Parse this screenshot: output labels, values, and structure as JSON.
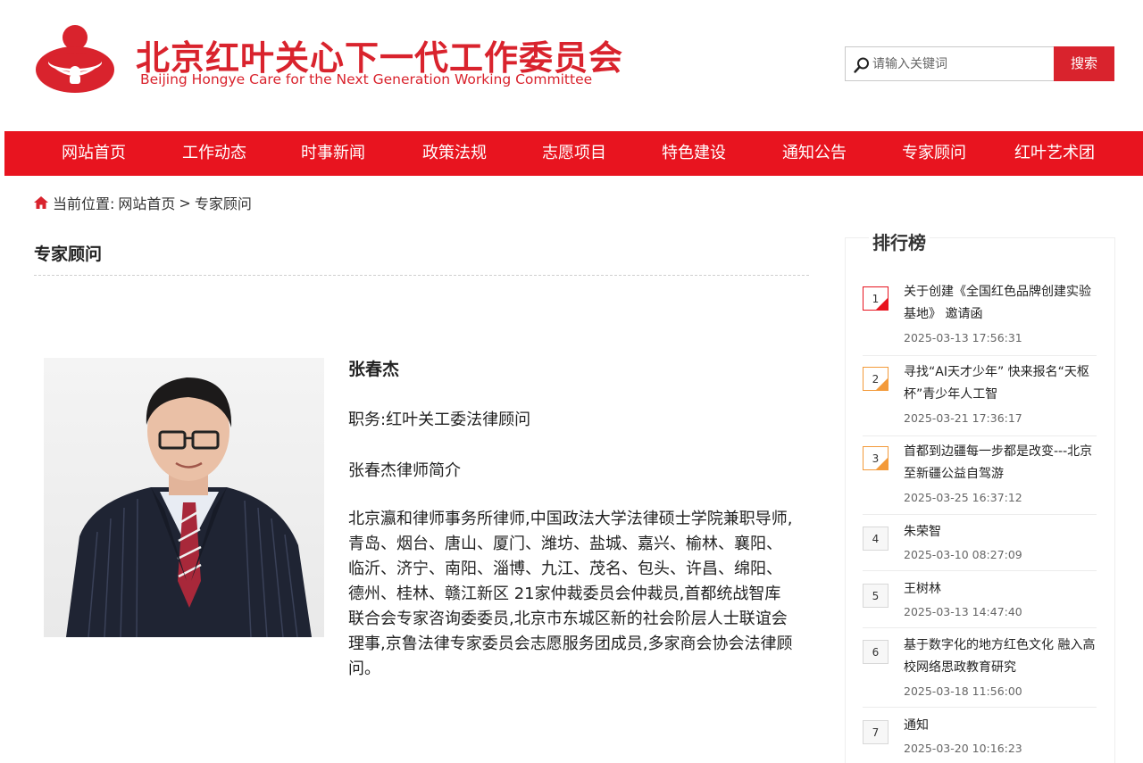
{
  "header": {
    "title_cn": "北京红叶关心下一代工作委员会",
    "title_en": "Beijing Hongye Care for the Next Generation Working Committee",
    "brand_color": "#d9232d",
    "logo_icon": "red-circle-child-logo-icon"
  },
  "search": {
    "placeholder": "请输入关键词",
    "button_label": "搜索",
    "icon": "search-icon"
  },
  "nav": {
    "background": "#e8141f",
    "items": [
      "网站首页",
      "工作动态",
      "时事新闻",
      "政策法规",
      "志愿项目",
      "特色建设",
      "通知公告",
      "专家顾问",
      "红叶艺术团"
    ]
  },
  "breadcrumb": {
    "icon": "home-icon",
    "label": "当前位置:",
    "home": "网站首页",
    "separator": ">",
    "current": "专家顾问"
  },
  "section": {
    "title": "专家顾问"
  },
  "profile": {
    "name": "张春杰",
    "position": "职务:红叶关工委法律顾问",
    "intro_title": "张春杰律师简介",
    "bio": "北京瀛和律师事务所律师,中国政法大学法律硕士学院兼职导师,青岛、烟台、唐山、厦门、潍坊、盐城、嘉兴、榆林、襄阳、临沂、济宁、南阳、淄博、九江、茂名、包头、许昌、绵阳、德州、桂林、赣江新区 21家仲裁委员会仲裁员,首都统战智库联合会专家咨询委委员,北京市东城区新的社会阶层人士联谊会理事,京鲁法律专家委员会志愿服务团成员,多家商会协会法律顾问。"
  },
  "ranking": {
    "title": "排行榜",
    "items": [
      {
        "rank": "1",
        "title": "关于创建《全国红色品牌创建实验基地》 邀请函",
        "date": "2025-03-13 17:56:31"
      },
      {
        "rank": "2",
        "title": "寻找“AI天才少年” 快来报名“天枢杯”青少年人工智",
        "date": "2025-03-21 17:36:17"
      },
      {
        "rank": "3",
        "title": "首都到边疆每一步都是改变---北京至新疆公益自驾游",
        "date": "2025-03-25 16:37:12"
      },
      {
        "rank": "4",
        "title": "朱荣智",
        "date": "2025-03-10 08:27:09"
      },
      {
        "rank": "5",
        "title": "王树林",
        "date": "2025-03-13 14:47:40"
      },
      {
        "rank": "6",
        "title": "基于数字化的地方红色文化 融入高校网络思政教育研究",
        "date": "2025-03-18 11:56:00"
      },
      {
        "rank": "7",
        "title": "通知",
        "date": "2025-03-20 10:16:23"
      }
    ]
  }
}
